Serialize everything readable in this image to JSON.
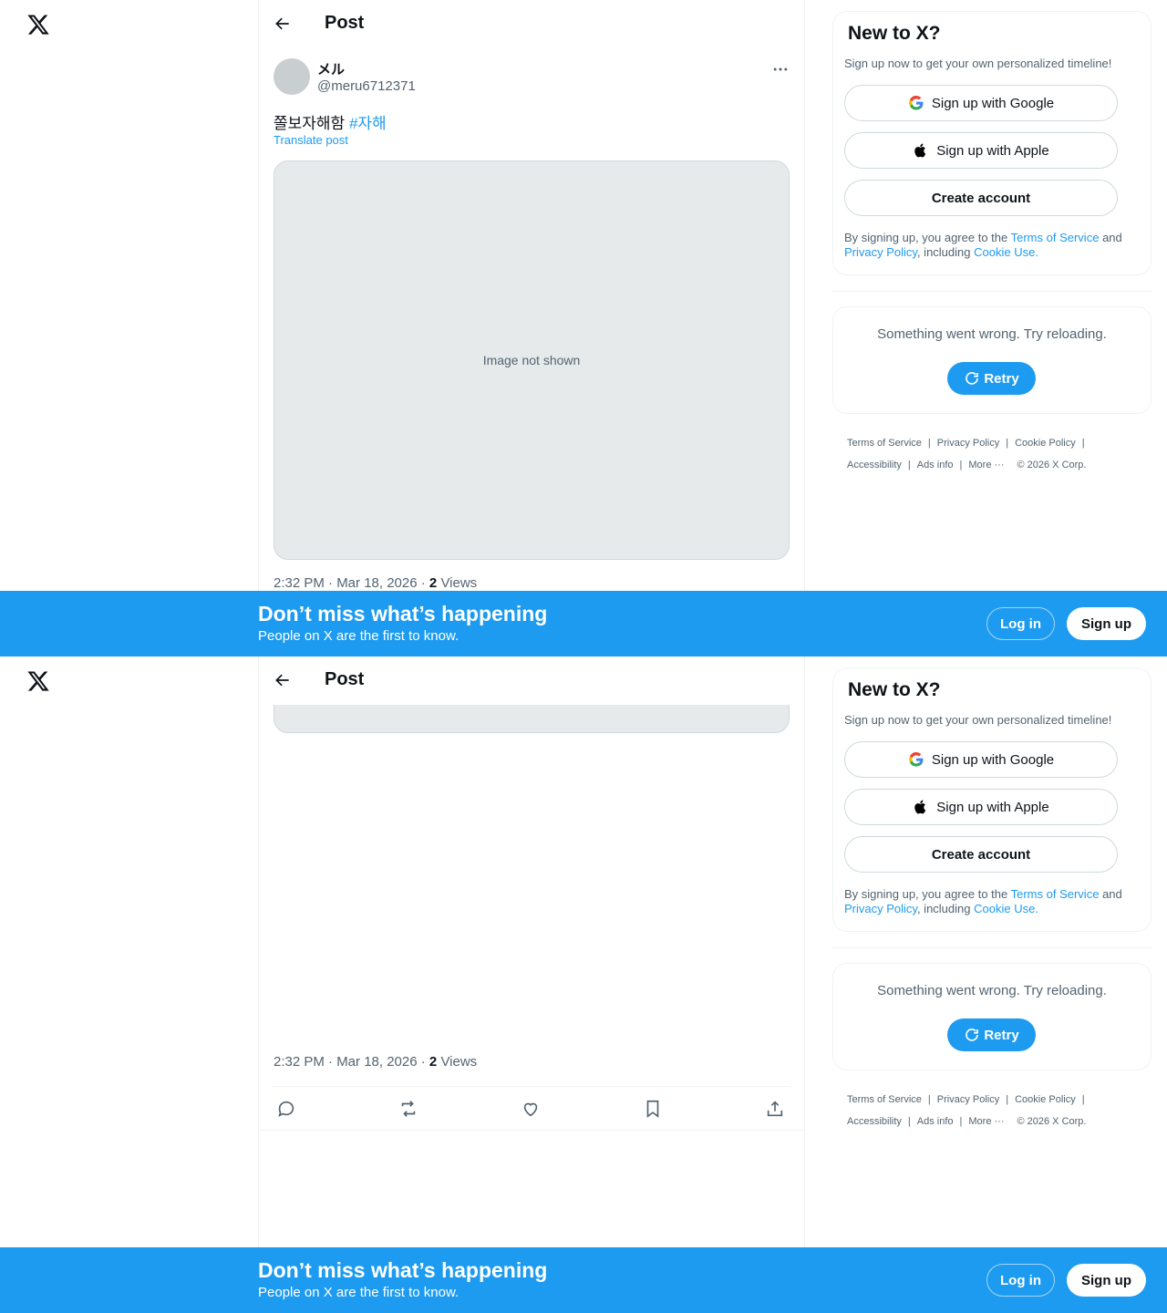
{
  "header": {
    "title": "Post"
  },
  "post": {
    "display_name": "メル",
    "handle": "@meru6712371",
    "text": "쫄보자해함",
    "hashtag": "#자해",
    "translate_label": "Translate post",
    "time": "2:32 PM · Mar 18, 2026 ·",
    "views_count": "2",
    "views_label": "Views",
    "media_notice": "Image not shown"
  },
  "signup_card": {
    "title": "New to X?",
    "subtitle": "Sign up now to get your own personalized timeline!",
    "google": "Sign up with Google",
    "apple": "Sign up with Apple",
    "create": "Create account",
    "terms_prefix": "By signing up, you agree to the",
    "terms_link": "Terms of Service",
    "and": "and",
    "privacy_link": "Privacy Policy",
    "including": ", including",
    "cookie_link": "Cookie Use."
  },
  "error_card": {
    "message": "Something went wrong. Try reloading.",
    "retry": "Retry"
  },
  "footer": {
    "terms": "Terms of Service",
    "privacy": "Privacy Policy",
    "cookie": "Cookie Policy",
    "accessibility": "Accessibility",
    "ads": "Ads info",
    "more": "More ···",
    "copyright": "© 2026 X Corp."
  },
  "banner": {
    "heading": "Don’t miss what’s happening",
    "sub": "People on X are the first to know.",
    "login": "Log in",
    "signup": "Sign up"
  },
  "colors": {
    "accent": "#1d9bf0",
    "text": "#0f1419",
    "secondary": "#536471"
  }
}
